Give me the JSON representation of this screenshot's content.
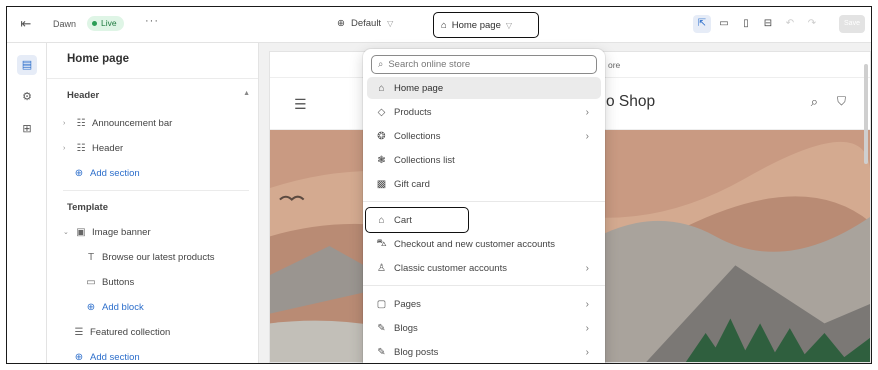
{
  "topbar": {
    "theme_name": "Dawn",
    "live_badge": "Live",
    "more": "···",
    "default_label": "Default",
    "page_selector": "Home page",
    "save_label": "Save"
  },
  "sidebar": {
    "title": "Home page",
    "header_group": "Header",
    "header_items": [
      "Announcement bar",
      "Header"
    ],
    "header_add": "Add section",
    "template_group": "Template",
    "image_banner": "Image banner",
    "banner_children": [
      "Browse our latest products",
      "Buttons"
    ],
    "add_block": "Add block",
    "featured": "Featured collection",
    "template_add": "Add section"
  },
  "preview": {
    "announcement_fragment": "ore",
    "shop_name_fragment": "o Shop"
  },
  "dropdown": {
    "search_placeholder": "Search online store",
    "items": [
      {
        "label": "Home page",
        "icon": "home-icon",
        "submenu": false,
        "selected": true
      },
      {
        "label": "Products",
        "icon": "tag-icon",
        "submenu": true
      },
      {
        "label": "Collections",
        "icon": "collection-icon",
        "submenu": true
      },
      {
        "label": "Collections list",
        "icon": "collections-list-icon",
        "submenu": false
      },
      {
        "label": "Gift card",
        "icon": "gift-card-icon",
        "submenu": false
      },
      {
        "label": "Cart",
        "icon": "cart-bag-icon",
        "submenu": false,
        "highlighted": true
      },
      {
        "label": "Checkout and new customer accounts",
        "icon": "checkout-icon",
        "submenu": false
      },
      {
        "label": "Classic customer accounts",
        "icon": "person-icon",
        "submenu": true
      },
      {
        "label": "Pages",
        "icon": "page-icon",
        "submenu": true
      },
      {
        "label": "Blogs",
        "icon": "blog-icon",
        "submenu": true
      },
      {
        "label": "Blog posts",
        "icon": "blog-post-icon",
        "submenu": true
      }
    ]
  },
  "colors": {
    "accent": "#2c6ecb",
    "live_green": "#2a9d55",
    "banner_bg": "#c79a82"
  }
}
